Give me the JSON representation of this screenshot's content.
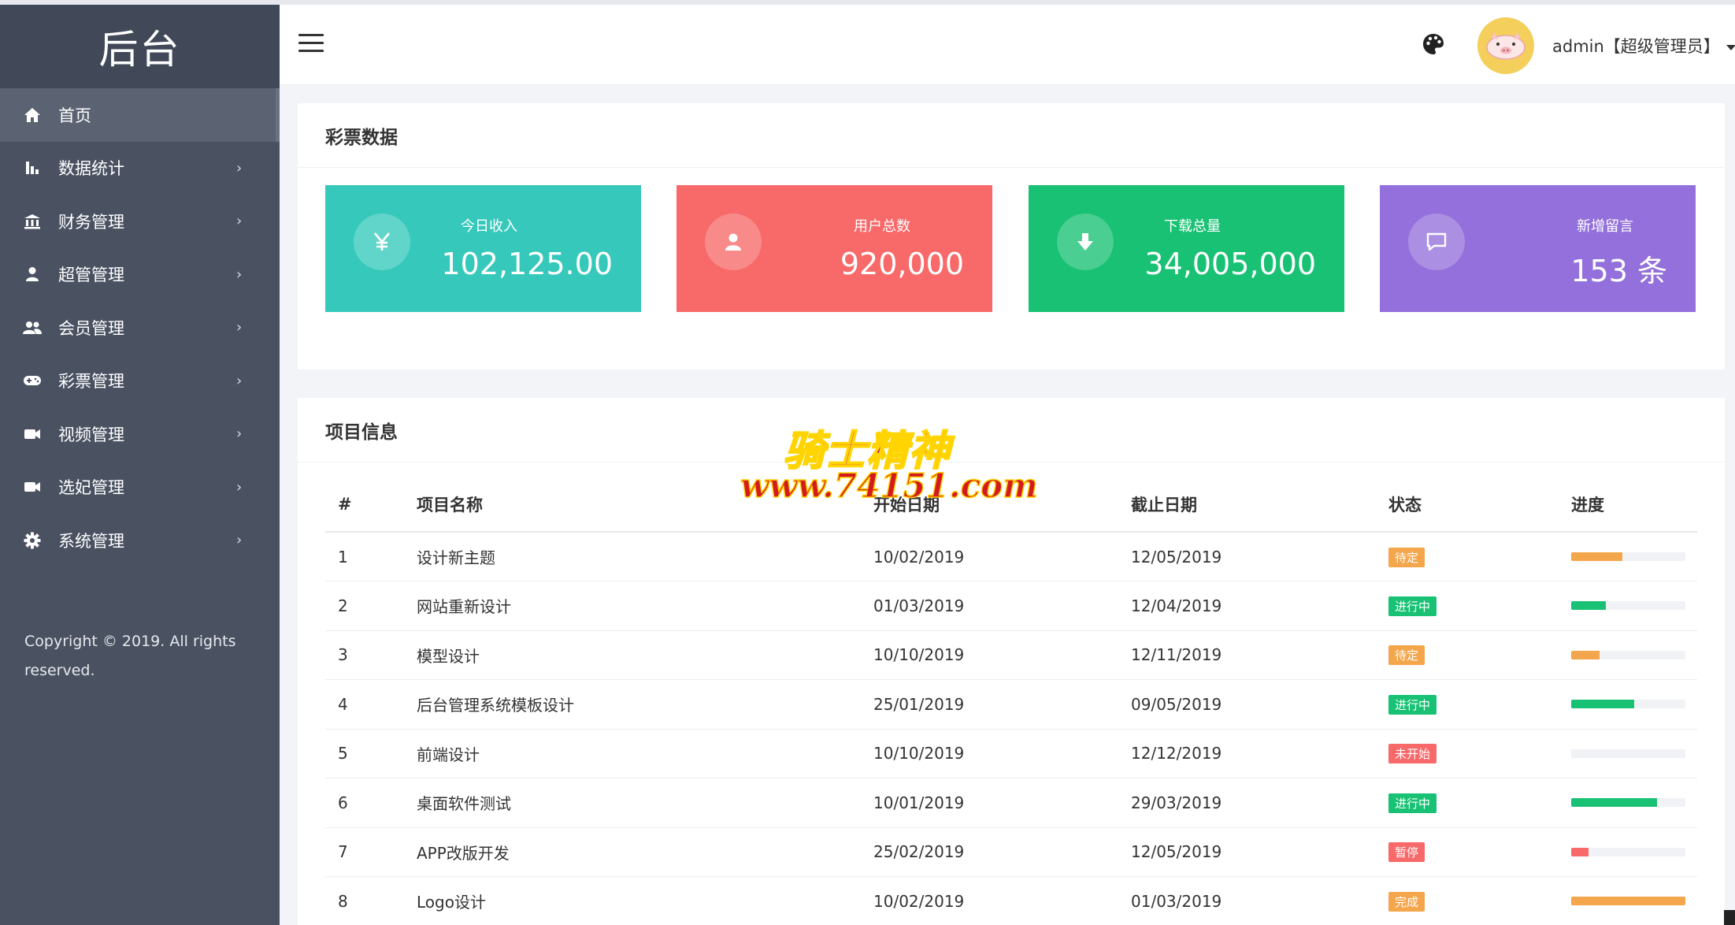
{
  "brand": "后台",
  "sidebar": {
    "items": [
      {
        "label": "首页",
        "icon": "home-icon"
      },
      {
        "label": "数据统计",
        "icon": "bar-chart-icon"
      },
      {
        "label": "财务管理",
        "icon": "bank-icon"
      },
      {
        "label": "超管管理",
        "icon": "user-icon"
      },
      {
        "label": "会员管理",
        "icon": "users-icon"
      },
      {
        "label": "彩票管理",
        "icon": "gamepad-icon"
      },
      {
        "label": "视频管理",
        "icon": "video-icon"
      },
      {
        "label": "选妃管理",
        "icon": "video-icon"
      },
      {
        "label": "系统管理",
        "icon": "gear-icon"
      }
    ],
    "arrow": "›",
    "copyright": "Copyright © 2019. All rights reserved."
  },
  "header": {
    "user": "admin【超级管理员】"
  },
  "lottery": {
    "title": "彩票数据",
    "stats": [
      {
        "label": "今日收入",
        "value": "102,125.00",
        "icon": "yen-icon",
        "color": "#36c9bb"
      },
      {
        "label": "用户总数",
        "value": "920,000",
        "icon": "user-icon",
        "color": "#f8696a"
      },
      {
        "label": "下载总量",
        "value": "34,005,000",
        "icon": "download-icon",
        "color": "#18c173"
      },
      {
        "label": "新增留言",
        "value": "153 条",
        "icon": "comment-icon",
        "color": "#9370db"
      }
    ]
  },
  "projects": {
    "title": "项目信息",
    "columns": [
      "#",
      "项目名称",
      "开始日期",
      "截止日期",
      "状态",
      "进度"
    ],
    "rows": [
      {
        "id": "1",
        "name": "设计新主题",
        "start": "10/02/2019",
        "end": "12/05/2019",
        "status": "待定",
        "status_color": "#f3a64b",
        "progress": 45
      },
      {
        "id": "2",
        "name": "网站重新设计",
        "start": "01/03/2019",
        "end": "12/04/2019",
        "status": "进行中",
        "status_color": "#18c173",
        "progress": 30
      },
      {
        "id": "3",
        "name": "模型设计",
        "start": "10/10/2019",
        "end": "12/11/2019",
        "status": "待定",
        "status_color": "#f3a64b",
        "progress": 25
      },
      {
        "id": "4",
        "name": "后台管理系统模板设计",
        "start": "25/01/2019",
        "end": "09/05/2019",
        "status": "进行中",
        "status_color": "#18c173",
        "progress": 55
      },
      {
        "id": "5",
        "name": "前端设计",
        "start": "10/10/2019",
        "end": "12/12/2019",
        "status": "未开始",
        "status_color": "#f8696a",
        "progress": 0
      },
      {
        "id": "6",
        "name": "桌面软件测试",
        "start": "10/01/2019",
        "end": "29/03/2019",
        "status": "进行中",
        "status_color": "#18c173",
        "progress": 75
      },
      {
        "id": "7",
        "name": "APP改版开发",
        "start": "25/02/2019",
        "end": "12/05/2019",
        "status": "暂停",
        "status_color": "#f8696a",
        "progress": 15
      },
      {
        "id": "8",
        "name": "Logo设计",
        "start": "10/02/2019",
        "end": "01/03/2019",
        "status": "完成",
        "status_color": "#f3a64b",
        "progress": 100
      }
    ]
  },
  "watermark": {
    "line1": "骑士精神",
    "line2": "www.74151.com"
  }
}
